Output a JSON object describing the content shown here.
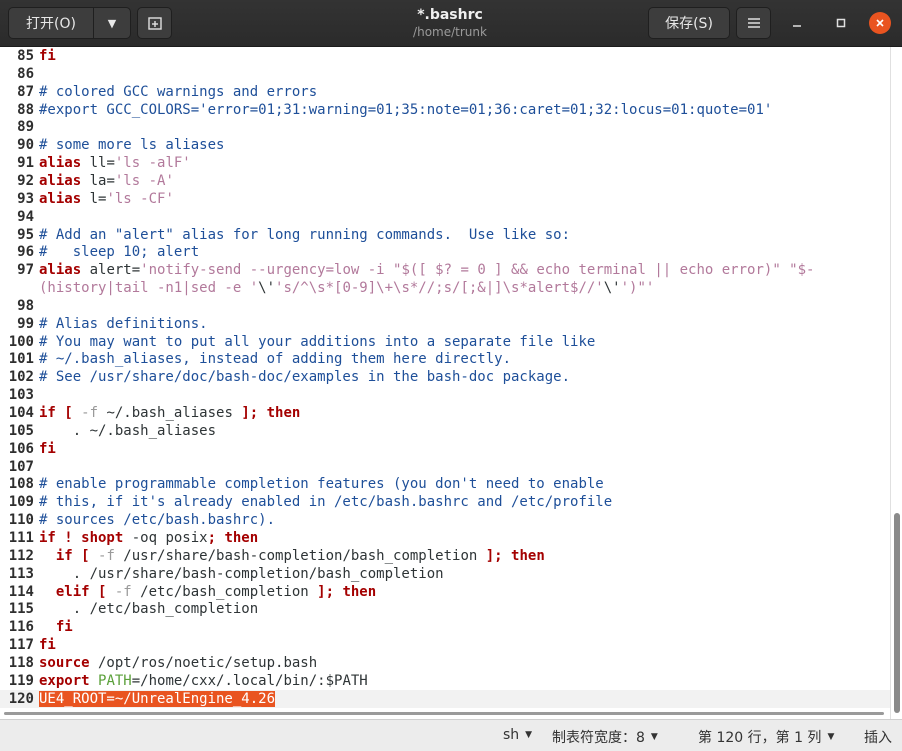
{
  "header": {
    "open_label": "打开(O)",
    "save_label": "保存(S)",
    "title": "*.bashrc",
    "subtitle": "/home/trunk"
  },
  "editor": {
    "lines": [
      {
        "n": "85",
        "parts": [
          [
            "fi",
            "c-kw"
          ]
        ]
      },
      {
        "n": "86",
        "parts": []
      },
      {
        "n": "87",
        "parts": [
          [
            "# colored GCC warnings and errors",
            "c-comment"
          ]
        ]
      },
      {
        "n": "88",
        "parts": [
          [
            "#export GCC_COLORS='error=01;31:warning=01;35:note=01;36:caret=01;32:locus=01:quote=01'",
            "c-comment"
          ]
        ]
      },
      {
        "n": "89",
        "parts": []
      },
      {
        "n": "90",
        "parts": [
          [
            "# some more ls aliases",
            "c-comment"
          ]
        ]
      },
      {
        "n": "91",
        "parts": [
          [
            "alias",
            "c-kw"
          ],
          [
            " ll=",
            ""
          ],
          [
            "'ls -alF'",
            "c-str"
          ]
        ]
      },
      {
        "n": "92",
        "parts": [
          [
            "alias",
            "c-kw"
          ],
          [
            " la=",
            ""
          ],
          [
            "'ls -A'",
            "c-str"
          ]
        ]
      },
      {
        "n": "93",
        "parts": [
          [
            "alias",
            "c-kw"
          ],
          [
            " l=",
            ""
          ],
          [
            "'ls -CF'",
            "c-str"
          ]
        ]
      },
      {
        "n": "94",
        "parts": []
      },
      {
        "n": "95",
        "parts": [
          [
            "# Add an \"alert\" alias for long running commands.  Use like so:",
            "c-comment"
          ]
        ]
      },
      {
        "n": "96",
        "parts": [
          [
            "#   sleep 10; alert",
            "c-comment"
          ]
        ]
      },
      {
        "n": "97",
        "parts": [
          [
            "alias",
            "c-kw"
          ],
          [
            " alert=",
            ""
          ],
          [
            "'notify-send --urgency=low -i \"$([ $? = 0 ] && echo terminal || echo error)\" \"$-",
            "c-str"
          ]
        ]
      },
      {
        "n": "",
        "parts": [
          [
            "(history|tail -n1|sed -e '",
            "c-str"
          ],
          [
            "\\'",
            ""
          ],
          [
            "'s/^\\s*[0-9]\\+\\s*//;s/[;&|]\\s*alert$//'",
            "c-str"
          ],
          [
            "\\'",
            ""
          ],
          [
            "')\"'",
            "c-str"
          ]
        ]
      },
      {
        "n": "98",
        "parts": []
      },
      {
        "n": "99",
        "parts": [
          [
            "# Alias definitions.",
            "c-comment"
          ]
        ]
      },
      {
        "n": "100",
        "parts": [
          [
            "# You may want to put all your additions into a separate file like",
            "c-comment"
          ]
        ]
      },
      {
        "n": "101",
        "parts": [
          [
            "# ~/.bash_aliases, instead of adding them here directly.",
            "c-comment"
          ]
        ]
      },
      {
        "n": "102",
        "parts": [
          [
            "# See /usr/share/doc/bash-doc/examples in the bash-doc package.",
            "c-comment"
          ]
        ]
      },
      {
        "n": "103",
        "parts": []
      },
      {
        "n": "104",
        "parts": [
          [
            "if [ ",
            "c-kw"
          ],
          [
            "-f",
            "c-opt"
          ],
          [
            " ~/.bash_aliases ",
            ""
          ],
          [
            "]; then",
            "c-kw"
          ]
        ]
      },
      {
        "n": "105",
        "parts": [
          [
            "    . ~/.bash_aliases",
            ""
          ]
        ]
      },
      {
        "n": "106",
        "parts": [
          [
            "fi",
            "c-kw"
          ]
        ]
      },
      {
        "n": "107",
        "parts": []
      },
      {
        "n": "108",
        "parts": [
          [
            "# enable programmable completion features (you don't need to enable",
            "c-comment"
          ]
        ]
      },
      {
        "n": "109",
        "parts": [
          [
            "# this, if it's already enabled in /etc/bash.bashrc and /etc/profile",
            "c-comment"
          ]
        ]
      },
      {
        "n": "110",
        "parts": [
          [
            "# sources /etc/bash.bashrc).",
            "c-comment"
          ]
        ]
      },
      {
        "n": "111",
        "parts": [
          [
            "if ! shopt",
            "c-kw"
          ],
          [
            " -oq posix",
            ""
          ],
          [
            "; then",
            "c-kw"
          ]
        ]
      },
      {
        "n": "112",
        "parts": [
          [
            "  if [ ",
            "c-kw"
          ],
          [
            "-f",
            "c-opt"
          ],
          [
            " /usr/share/bash-completion/bash_completion ",
            ""
          ],
          [
            "]; then",
            "c-kw"
          ]
        ]
      },
      {
        "n": "113",
        "parts": [
          [
            "    . /usr/share/bash-completion/bash_completion",
            ""
          ]
        ]
      },
      {
        "n": "114",
        "parts": [
          [
            "  elif [ ",
            "c-kw"
          ],
          [
            "-f",
            "c-opt"
          ],
          [
            " /etc/bash_completion ",
            ""
          ],
          [
            "]; then",
            "c-kw"
          ]
        ]
      },
      {
        "n": "115",
        "parts": [
          [
            "    . /etc/bash_completion",
            ""
          ]
        ]
      },
      {
        "n": "116",
        "parts": [
          [
            "  fi",
            "c-kw"
          ]
        ]
      },
      {
        "n": "117",
        "parts": [
          [
            "fi",
            "c-kw"
          ]
        ]
      },
      {
        "n": "118",
        "parts": [
          [
            "source",
            "c-kw"
          ],
          [
            " /opt/ros/noetic/setup.bash",
            ""
          ]
        ]
      },
      {
        "n": "119",
        "parts": [
          [
            "export",
            "c-kw"
          ],
          [
            " ",
            ""
          ],
          [
            "PATH",
            "c-var"
          ],
          [
            "=/home/cxx/.local/bin/:$PATH",
            ""
          ]
        ]
      },
      {
        "n": "120",
        "parts": [
          [
            "UE4_ROOT=~/UnrealEngine_4.26",
            "c-sel"
          ]
        ],
        "current": true
      }
    ]
  },
  "statusbar": {
    "language": "sh",
    "tab_width": "制表符宽度：8",
    "position": "第 120 行，第 1 列",
    "insert_mode": "插入"
  }
}
